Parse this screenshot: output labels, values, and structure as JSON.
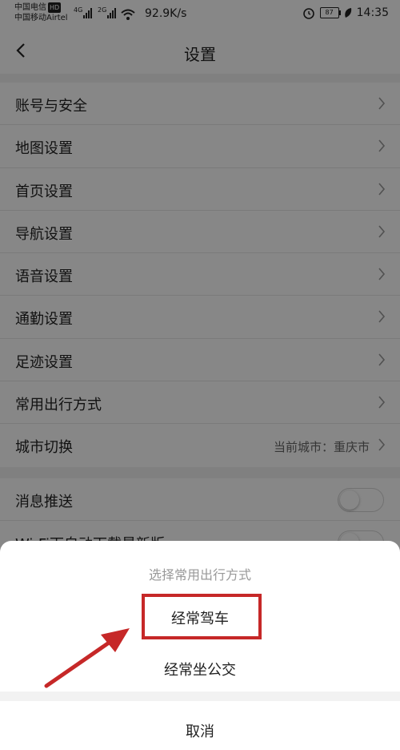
{
  "status_bar": {
    "carrier_1": "中国电信",
    "carrier_1_badge": "HD",
    "carrier_2": "中国移动Airtel",
    "sig_1": "4G",
    "sig_2": "2G",
    "speed": "92.9K/s",
    "battery": "87",
    "time": "14:35"
  },
  "header": {
    "title": "设置"
  },
  "settings": {
    "items": [
      {
        "label": "账号与安全"
      },
      {
        "label": "地图设置"
      },
      {
        "label": "首页设置"
      },
      {
        "label": "导航设置"
      },
      {
        "label": "语音设置"
      },
      {
        "label": "通勤设置"
      },
      {
        "label": "足迹设置"
      },
      {
        "label": "常用出行方式"
      },
      {
        "label": "城市切换",
        "value": "当前城市：重庆市"
      }
    ],
    "toggles": [
      {
        "label": "消息推送"
      },
      {
        "label": "Wi-Fi下自动下载最新版"
      }
    ]
  },
  "sheet": {
    "title": "选择常用出行方式",
    "options": [
      "经常驾车",
      "经常坐公交"
    ],
    "cancel": "取消"
  },
  "colors": {
    "highlight": "#c62828",
    "background": "#f2f2f2"
  },
  "icons": {
    "back": "chevron-left-icon",
    "row": "chevron-right-icon",
    "annotation": "red-arrow-icon"
  }
}
